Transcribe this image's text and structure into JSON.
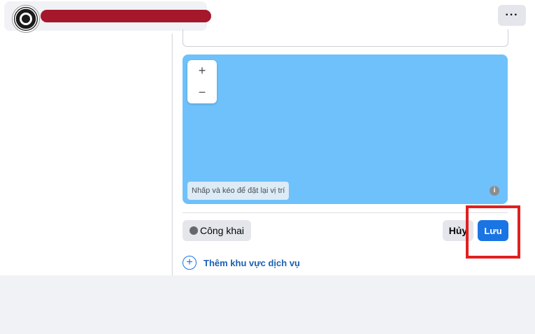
{
  "header": {
    "menu_label": "···"
  },
  "map": {
    "zoom_in": "+",
    "zoom_out": "−",
    "hint": "Nhấp và kéo để đặt lại vị trí",
    "info": "i"
  },
  "actions": {
    "privacy_label": "Công khai",
    "cancel_label": "Hủy",
    "save_label": "Lưu"
  },
  "add_service_area": {
    "icon": "+",
    "label": "Thêm khu vực dịch vụ"
  },
  "colors": {
    "map": "#6ec1fb",
    "save_button": "#1b74e4",
    "highlight": "#e02020",
    "redaction": "#a5182c"
  }
}
